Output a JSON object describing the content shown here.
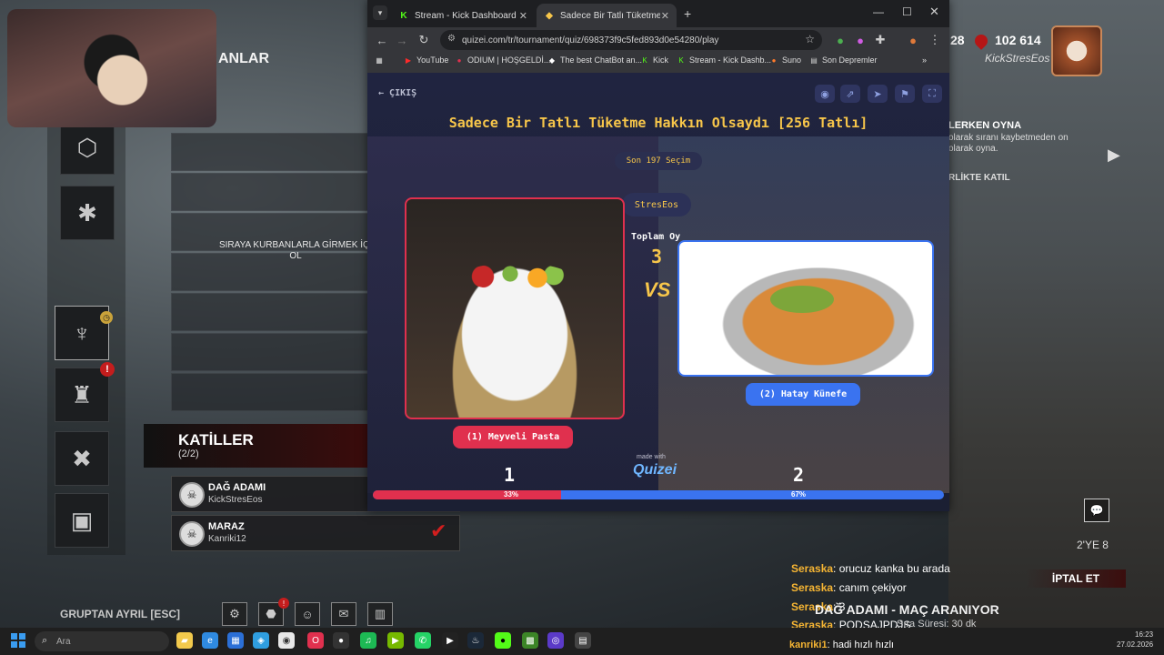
{
  "game": {
    "anlar_title": "ANLAR",
    "kurban_text": "SIRAYA KURBANLARLA GİRMEK İÇİ OL",
    "killers_title": "KATİLLER",
    "killers_count": "(2/2)",
    "killers": [
      {
        "name": "DAĞ ADAMI",
        "user": "KickStresEos"
      },
      {
        "name": "MARAZ",
        "user": "Kanriki12"
      }
    ],
    "leave_group": "GRUPTAN AYRIL [ESC]",
    "score": "28",
    "points": "102 614",
    "player_name": "KickStresEos",
    "play_together_title": "LERKEN OYNA",
    "play_together_desc": "olarak sıranı kaybetmeden on olarak oyna.",
    "birlikte": "RLİKTE KATIL",
    "ye8": "2'YE 8",
    "cancel": "İPTAL ET",
    "status": "DAĞ ADAMI - MAÇ ARANIYOR",
    "queue_time": "Sıra Süresi: 30 dk"
  },
  "chat": [
    {
      "user": "Seraska",
      "msg": ": orucuz kanka bu arada"
    },
    {
      "user": "Seraska",
      "msg": ": canım çekiyor"
    },
    {
      "user": "Seraska",
      "msg": ": 3"
    },
    {
      "user": "Seraska",
      "msg": ": PODSAJPDJS"
    }
  ],
  "pinned_chat": {
    "user": "kanriki1",
    "msg": ": hadi hızlı hızlı"
  },
  "browser": {
    "tabs": [
      {
        "label": "Stream - Kick Dashboard"
      },
      {
        "label": "Sadece Bir Tatlı Tüketme Hakkın"
      }
    ],
    "url": "quizei.com/tr/tournament/quiz/698373f9c5fed893d0e54280/play",
    "bookmarks": [
      "YouTube",
      "ODIUM | HOŞGELDİ...",
      "The best ChatBot an...",
      "Kick",
      "Stream - Kick Dashb...",
      "Suno",
      "Son Depremler"
    ]
  },
  "quiz": {
    "exit": "ÇIKIŞ",
    "title": "Sadece Bir Tatlı Tüketme Hakkın Olsaydı [256 Tatlı]",
    "remaining": "Son 197 Seçim",
    "streamer": "StresEos",
    "total_label": "Toplam Oy",
    "total_value": "3",
    "vs": "VS",
    "option1": "(1) Meyveli Pasta",
    "option2": "(2) Hatay Künefe",
    "made_with": "made with",
    "logo": "Quizei",
    "count1": "1",
    "count2": "2",
    "pct1": "33%",
    "pct2": "67%",
    "share1": 0.33
  },
  "taskbar": {
    "search_placeholder": "Ara",
    "time": "16:23",
    "date": "27.02.2026"
  }
}
